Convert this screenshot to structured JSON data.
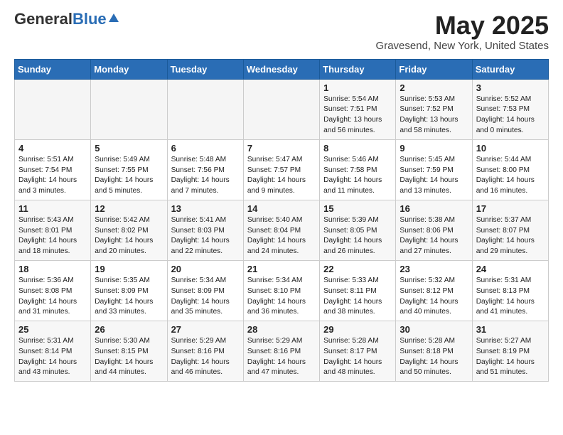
{
  "header": {
    "logo_general": "General",
    "logo_blue": "Blue",
    "month_title": "May 2025",
    "location": "Gravesend, New York, United States"
  },
  "weekdays": [
    "Sunday",
    "Monday",
    "Tuesday",
    "Wednesday",
    "Thursday",
    "Friday",
    "Saturday"
  ],
  "weeks": [
    [
      {
        "day": "",
        "info": ""
      },
      {
        "day": "",
        "info": ""
      },
      {
        "day": "",
        "info": ""
      },
      {
        "day": "",
        "info": ""
      },
      {
        "day": "1",
        "info": "Sunrise: 5:54 AM\nSunset: 7:51 PM\nDaylight: 13 hours\nand 56 minutes."
      },
      {
        "day": "2",
        "info": "Sunrise: 5:53 AM\nSunset: 7:52 PM\nDaylight: 13 hours\nand 58 minutes."
      },
      {
        "day": "3",
        "info": "Sunrise: 5:52 AM\nSunset: 7:53 PM\nDaylight: 14 hours\nand 0 minutes."
      }
    ],
    [
      {
        "day": "4",
        "info": "Sunrise: 5:51 AM\nSunset: 7:54 PM\nDaylight: 14 hours\nand 3 minutes."
      },
      {
        "day": "5",
        "info": "Sunrise: 5:49 AM\nSunset: 7:55 PM\nDaylight: 14 hours\nand 5 minutes."
      },
      {
        "day": "6",
        "info": "Sunrise: 5:48 AM\nSunset: 7:56 PM\nDaylight: 14 hours\nand 7 minutes."
      },
      {
        "day": "7",
        "info": "Sunrise: 5:47 AM\nSunset: 7:57 PM\nDaylight: 14 hours\nand 9 minutes."
      },
      {
        "day": "8",
        "info": "Sunrise: 5:46 AM\nSunset: 7:58 PM\nDaylight: 14 hours\nand 11 minutes."
      },
      {
        "day": "9",
        "info": "Sunrise: 5:45 AM\nSunset: 7:59 PM\nDaylight: 14 hours\nand 13 minutes."
      },
      {
        "day": "10",
        "info": "Sunrise: 5:44 AM\nSunset: 8:00 PM\nDaylight: 14 hours\nand 16 minutes."
      }
    ],
    [
      {
        "day": "11",
        "info": "Sunrise: 5:43 AM\nSunset: 8:01 PM\nDaylight: 14 hours\nand 18 minutes."
      },
      {
        "day": "12",
        "info": "Sunrise: 5:42 AM\nSunset: 8:02 PM\nDaylight: 14 hours\nand 20 minutes."
      },
      {
        "day": "13",
        "info": "Sunrise: 5:41 AM\nSunset: 8:03 PM\nDaylight: 14 hours\nand 22 minutes."
      },
      {
        "day": "14",
        "info": "Sunrise: 5:40 AM\nSunset: 8:04 PM\nDaylight: 14 hours\nand 24 minutes."
      },
      {
        "day": "15",
        "info": "Sunrise: 5:39 AM\nSunset: 8:05 PM\nDaylight: 14 hours\nand 26 minutes."
      },
      {
        "day": "16",
        "info": "Sunrise: 5:38 AM\nSunset: 8:06 PM\nDaylight: 14 hours\nand 27 minutes."
      },
      {
        "day": "17",
        "info": "Sunrise: 5:37 AM\nSunset: 8:07 PM\nDaylight: 14 hours\nand 29 minutes."
      }
    ],
    [
      {
        "day": "18",
        "info": "Sunrise: 5:36 AM\nSunset: 8:08 PM\nDaylight: 14 hours\nand 31 minutes."
      },
      {
        "day": "19",
        "info": "Sunrise: 5:35 AM\nSunset: 8:09 PM\nDaylight: 14 hours\nand 33 minutes."
      },
      {
        "day": "20",
        "info": "Sunrise: 5:34 AM\nSunset: 8:09 PM\nDaylight: 14 hours\nand 35 minutes."
      },
      {
        "day": "21",
        "info": "Sunrise: 5:34 AM\nSunset: 8:10 PM\nDaylight: 14 hours\nand 36 minutes."
      },
      {
        "day": "22",
        "info": "Sunrise: 5:33 AM\nSunset: 8:11 PM\nDaylight: 14 hours\nand 38 minutes."
      },
      {
        "day": "23",
        "info": "Sunrise: 5:32 AM\nSunset: 8:12 PM\nDaylight: 14 hours\nand 40 minutes."
      },
      {
        "day": "24",
        "info": "Sunrise: 5:31 AM\nSunset: 8:13 PM\nDaylight: 14 hours\nand 41 minutes."
      }
    ],
    [
      {
        "day": "25",
        "info": "Sunrise: 5:31 AM\nSunset: 8:14 PM\nDaylight: 14 hours\nand 43 minutes."
      },
      {
        "day": "26",
        "info": "Sunrise: 5:30 AM\nSunset: 8:15 PM\nDaylight: 14 hours\nand 44 minutes."
      },
      {
        "day": "27",
        "info": "Sunrise: 5:29 AM\nSunset: 8:16 PM\nDaylight: 14 hours\nand 46 minutes."
      },
      {
        "day": "28",
        "info": "Sunrise: 5:29 AM\nSunset: 8:16 PM\nDaylight: 14 hours\nand 47 minutes."
      },
      {
        "day": "29",
        "info": "Sunrise: 5:28 AM\nSunset: 8:17 PM\nDaylight: 14 hours\nand 48 minutes."
      },
      {
        "day": "30",
        "info": "Sunrise: 5:28 AM\nSunset: 8:18 PM\nDaylight: 14 hours\nand 50 minutes."
      },
      {
        "day": "31",
        "info": "Sunrise: 5:27 AM\nSunset: 8:19 PM\nDaylight: 14 hours\nand 51 minutes."
      }
    ]
  ]
}
